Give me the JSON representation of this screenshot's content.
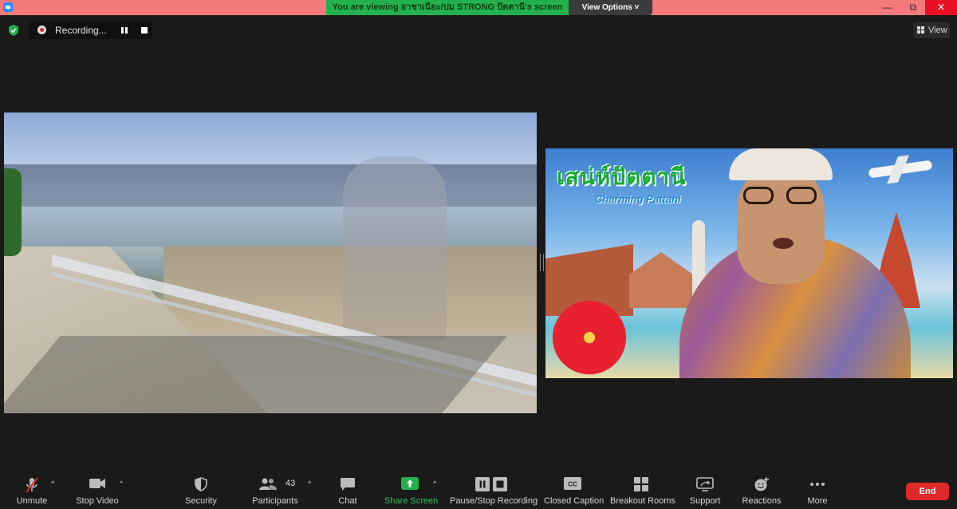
{
  "window": {
    "banner_text": "You are viewing อาชาเนียะ/ปม STRONG ปัตตานี's screen",
    "view_options_label": "View Options ˅",
    "minimize_glyph": "—",
    "maximize_glyph": "⧉",
    "close_glyph": "✕"
  },
  "recording": {
    "status_text": "Recording..."
  },
  "view_button": {
    "label": "View"
  },
  "speaker": {
    "banner_title": "เสน่ห์ปัตตานี",
    "banner_subtitle": "Charming Pattani"
  },
  "toolbar": {
    "unmute_label": "Unmute",
    "stop_video_label": "Stop Video",
    "security_label": "Security",
    "participants_label": "Participants",
    "participants_count": "43",
    "chat_label": "Chat",
    "share_screen_label": "Share Screen",
    "recording_label": "Pause/Stop Recording",
    "closed_caption_label": "Closed Caption",
    "breakout_label": "Breakout Rooms",
    "support_label": "Support",
    "reactions_label": "Reactions",
    "more_label": "More",
    "end_label": "End",
    "caret_glyph": "^"
  },
  "colors": {
    "title_bar": "#f4797a",
    "viewing_banner": "#22b14c",
    "share_screen_green": "#22b14c",
    "end_button": "#e02828",
    "background": "#1a1a1a"
  }
}
